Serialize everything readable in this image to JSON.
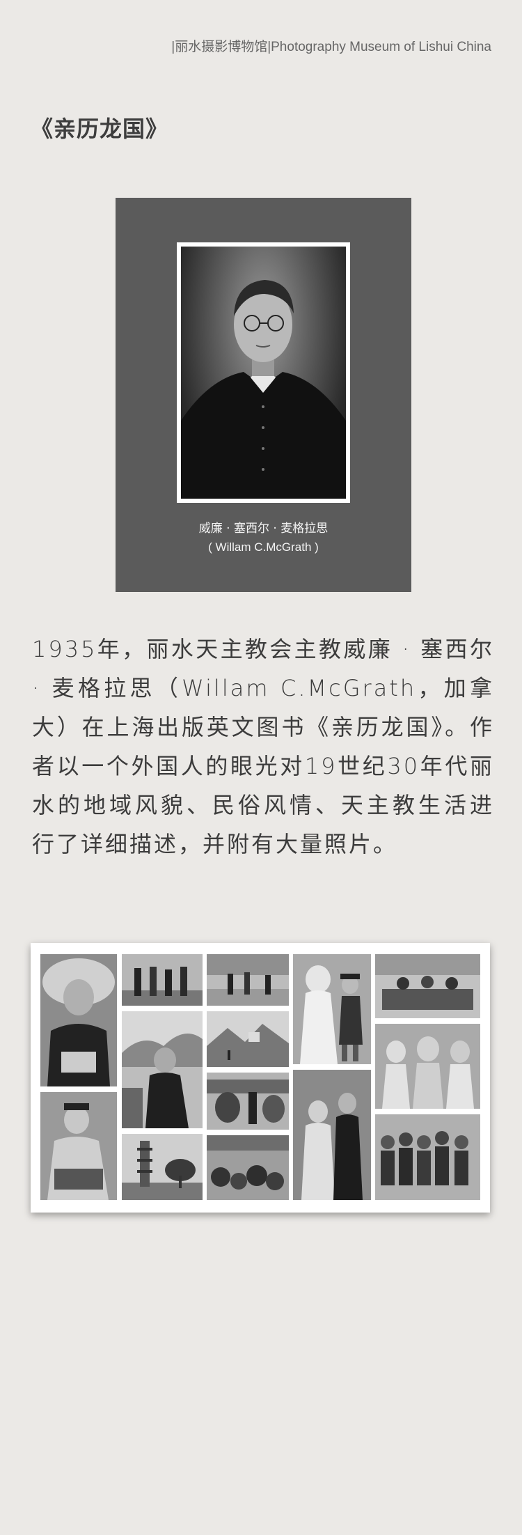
{
  "header": {
    "museum_label": "|丽水摄影博物馆|Photography Museum of Lishui China"
  },
  "title": "《亲历龙国》",
  "portrait": {
    "caption_cn": "威廉 · 塞西尔 · 麦格拉思",
    "caption_en": "( Willam C.McGrath )"
  },
  "body": {
    "paragraph": "1935年，丽水天主教会主教威廉 · 塞西尔 · 麦格拉思（Willam C.McGrath，加拿大）在上海出版英文图书《亲历龙国》。作者以一个外国人的眼光对19世纪30年代丽水的地域风貌、民俗风情、天主教生活进行了详细描述，并附有大量照片。"
  }
}
